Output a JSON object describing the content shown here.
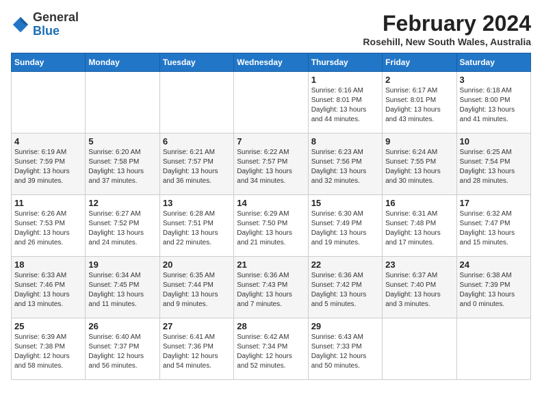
{
  "logo": {
    "general": "General",
    "blue": "Blue"
  },
  "title": {
    "month_year": "February 2024",
    "location": "Rosehill, New South Wales, Australia"
  },
  "headers": [
    "Sunday",
    "Monday",
    "Tuesday",
    "Wednesday",
    "Thursday",
    "Friday",
    "Saturday"
  ],
  "weeks": [
    [
      {
        "day": "",
        "info": ""
      },
      {
        "day": "",
        "info": ""
      },
      {
        "day": "",
        "info": ""
      },
      {
        "day": "",
        "info": ""
      },
      {
        "day": "1",
        "info": "Sunrise: 6:16 AM\nSunset: 8:01 PM\nDaylight: 13 hours\nand 44 minutes."
      },
      {
        "day": "2",
        "info": "Sunrise: 6:17 AM\nSunset: 8:01 PM\nDaylight: 13 hours\nand 43 minutes."
      },
      {
        "day": "3",
        "info": "Sunrise: 6:18 AM\nSunset: 8:00 PM\nDaylight: 13 hours\nand 41 minutes."
      }
    ],
    [
      {
        "day": "4",
        "info": "Sunrise: 6:19 AM\nSunset: 7:59 PM\nDaylight: 13 hours\nand 39 minutes."
      },
      {
        "day": "5",
        "info": "Sunrise: 6:20 AM\nSunset: 7:58 PM\nDaylight: 13 hours\nand 37 minutes."
      },
      {
        "day": "6",
        "info": "Sunrise: 6:21 AM\nSunset: 7:57 PM\nDaylight: 13 hours\nand 36 minutes."
      },
      {
        "day": "7",
        "info": "Sunrise: 6:22 AM\nSunset: 7:57 PM\nDaylight: 13 hours\nand 34 minutes."
      },
      {
        "day": "8",
        "info": "Sunrise: 6:23 AM\nSunset: 7:56 PM\nDaylight: 13 hours\nand 32 minutes."
      },
      {
        "day": "9",
        "info": "Sunrise: 6:24 AM\nSunset: 7:55 PM\nDaylight: 13 hours\nand 30 minutes."
      },
      {
        "day": "10",
        "info": "Sunrise: 6:25 AM\nSunset: 7:54 PM\nDaylight: 13 hours\nand 28 minutes."
      }
    ],
    [
      {
        "day": "11",
        "info": "Sunrise: 6:26 AM\nSunset: 7:53 PM\nDaylight: 13 hours\nand 26 minutes."
      },
      {
        "day": "12",
        "info": "Sunrise: 6:27 AM\nSunset: 7:52 PM\nDaylight: 13 hours\nand 24 minutes."
      },
      {
        "day": "13",
        "info": "Sunrise: 6:28 AM\nSunset: 7:51 PM\nDaylight: 13 hours\nand 22 minutes."
      },
      {
        "day": "14",
        "info": "Sunrise: 6:29 AM\nSunset: 7:50 PM\nDaylight: 13 hours\nand 21 minutes."
      },
      {
        "day": "15",
        "info": "Sunrise: 6:30 AM\nSunset: 7:49 PM\nDaylight: 13 hours\nand 19 minutes."
      },
      {
        "day": "16",
        "info": "Sunrise: 6:31 AM\nSunset: 7:48 PM\nDaylight: 13 hours\nand 17 minutes."
      },
      {
        "day": "17",
        "info": "Sunrise: 6:32 AM\nSunset: 7:47 PM\nDaylight: 13 hours\nand 15 minutes."
      }
    ],
    [
      {
        "day": "18",
        "info": "Sunrise: 6:33 AM\nSunset: 7:46 PM\nDaylight: 13 hours\nand 13 minutes."
      },
      {
        "day": "19",
        "info": "Sunrise: 6:34 AM\nSunset: 7:45 PM\nDaylight: 13 hours\nand 11 minutes."
      },
      {
        "day": "20",
        "info": "Sunrise: 6:35 AM\nSunset: 7:44 PM\nDaylight: 13 hours\nand 9 minutes."
      },
      {
        "day": "21",
        "info": "Sunrise: 6:36 AM\nSunset: 7:43 PM\nDaylight: 13 hours\nand 7 minutes."
      },
      {
        "day": "22",
        "info": "Sunrise: 6:36 AM\nSunset: 7:42 PM\nDaylight: 13 hours\nand 5 minutes."
      },
      {
        "day": "23",
        "info": "Sunrise: 6:37 AM\nSunset: 7:40 PM\nDaylight: 13 hours\nand 3 minutes."
      },
      {
        "day": "24",
        "info": "Sunrise: 6:38 AM\nSunset: 7:39 PM\nDaylight: 13 hours\nand 0 minutes."
      }
    ],
    [
      {
        "day": "25",
        "info": "Sunrise: 6:39 AM\nSunset: 7:38 PM\nDaylight: 12 hours\nand 58 minutes."
      },
      {
        "day": "26",
        "info": "Sunrise: 6:40 AM\nSunset: 7:37 PM\nDaylight: 12 hours\nand 56 minutes."
      },
      {
        "day": "27",
        "info": "Sunrise: 6:41 AM\nSunset: 7:36 PM\nDaylight: 12 hours\nand 54 minutes."
      },
      {
        "day": "28",
        "info": "Sunrise: 6:42 AM\nSunset: 7:34 PM\nDaylight: 12 hours\nand 52 minutes."
      },
      {
        "day": "29",
        "info": "Sunrise: 6:43 AM\nSunset: 7:33 PM\nDaylight: 12 hours\nand 50 minutes."
      },
      {
        "day": "",
        "info": ""
      },
      {
        "day": "",
        "info": ""
      }
    ]
  ]
}
